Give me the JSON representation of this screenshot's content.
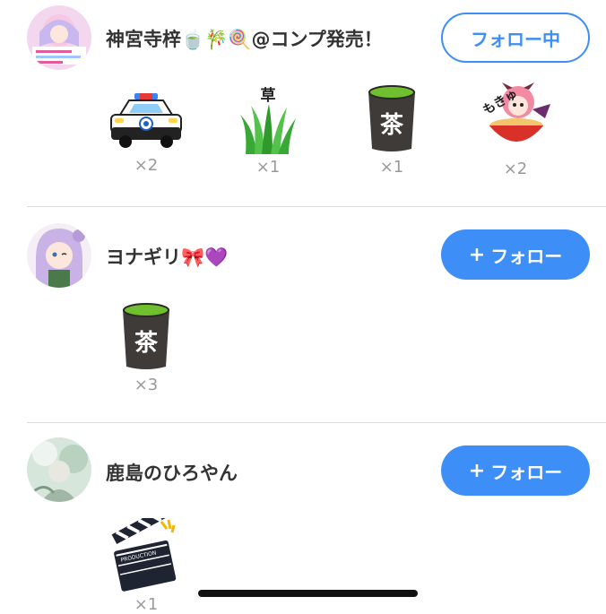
{
  "entries": [
    {
      "name": "神宮寺梓🍵🎋🍭@コンプ発売！",
      "button": "フォロー中",
      "gifts": [
        {
          "icon": "police-car-icon",
          "count": "×2"
        },
        {
          "icon": "grass-icon",
          "label": "草",
          "count": "×1"
        },
        {
          "icon": "tea-cup-icon",
          "label": "茶",
          "count": "×1"
        },
        {
          "icon": "ramen-girl-sticker-icon",
          "label": "もきゅ",
          "count": "×2"
        }
      ]
    },
    {
      "name": "ヨナギリ🎀💜",
      "button": "フォロー",
      "gifts": [
        {
          "icon": "tea-cup-icon",
          "label": "茶",
          "count": "×3"
        }
      ]
    },
    {
      "name": "鹿島のひろやん",
      "button": "フォロー",
      "gifts": [
        {
          "icon": "clapperboard-icon",
          "label": "PRODUCTION",
          "count": "×1"
        }
      ]
    }
  ],
  "colors": {
    "accent": "#3e8ef7",
    "count_text": "#999999",
    "divider": "#dcdcdc"
  }
}
